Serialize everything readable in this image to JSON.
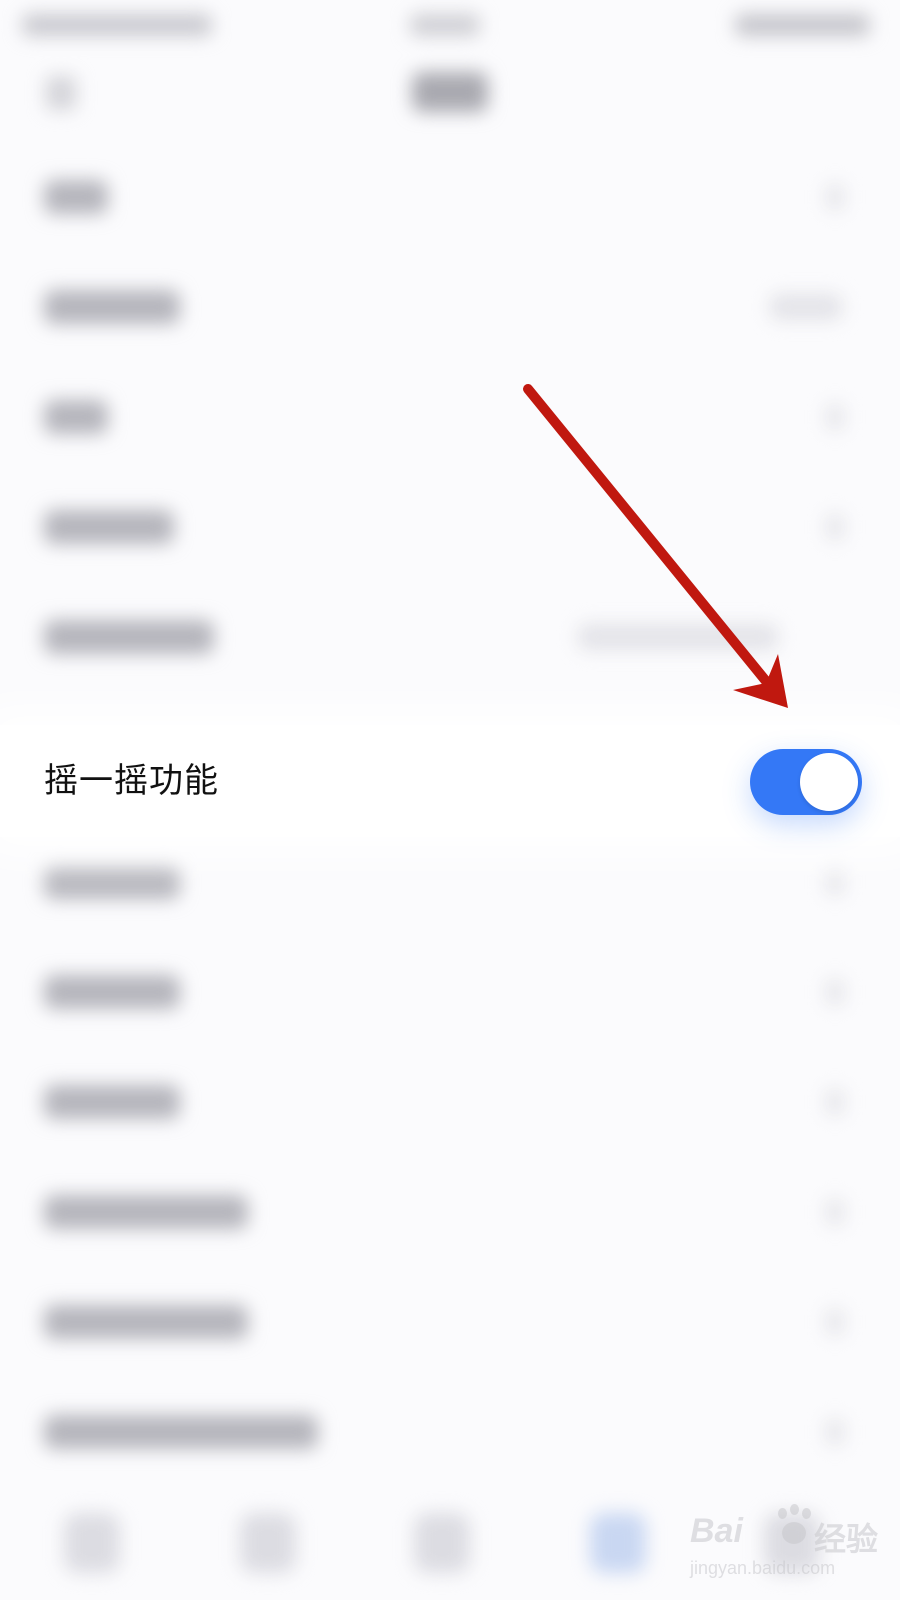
{
  "focused_setting": {
    "label": "摇一摇功能",
    "enabled": true
  },
  "colors": {
    "toggle_on": "#3478f6",
    "arrow": "#c0180f",
    "background": "#fbfbfd"
  },
  "annotation": {
    "icon": "red-arrow-icon"
  },
  "watermark": {
    "brand_left": "Bai",
    "brand_right": "经验",
    "url": "jingyan.baidu.com"
  }
}
